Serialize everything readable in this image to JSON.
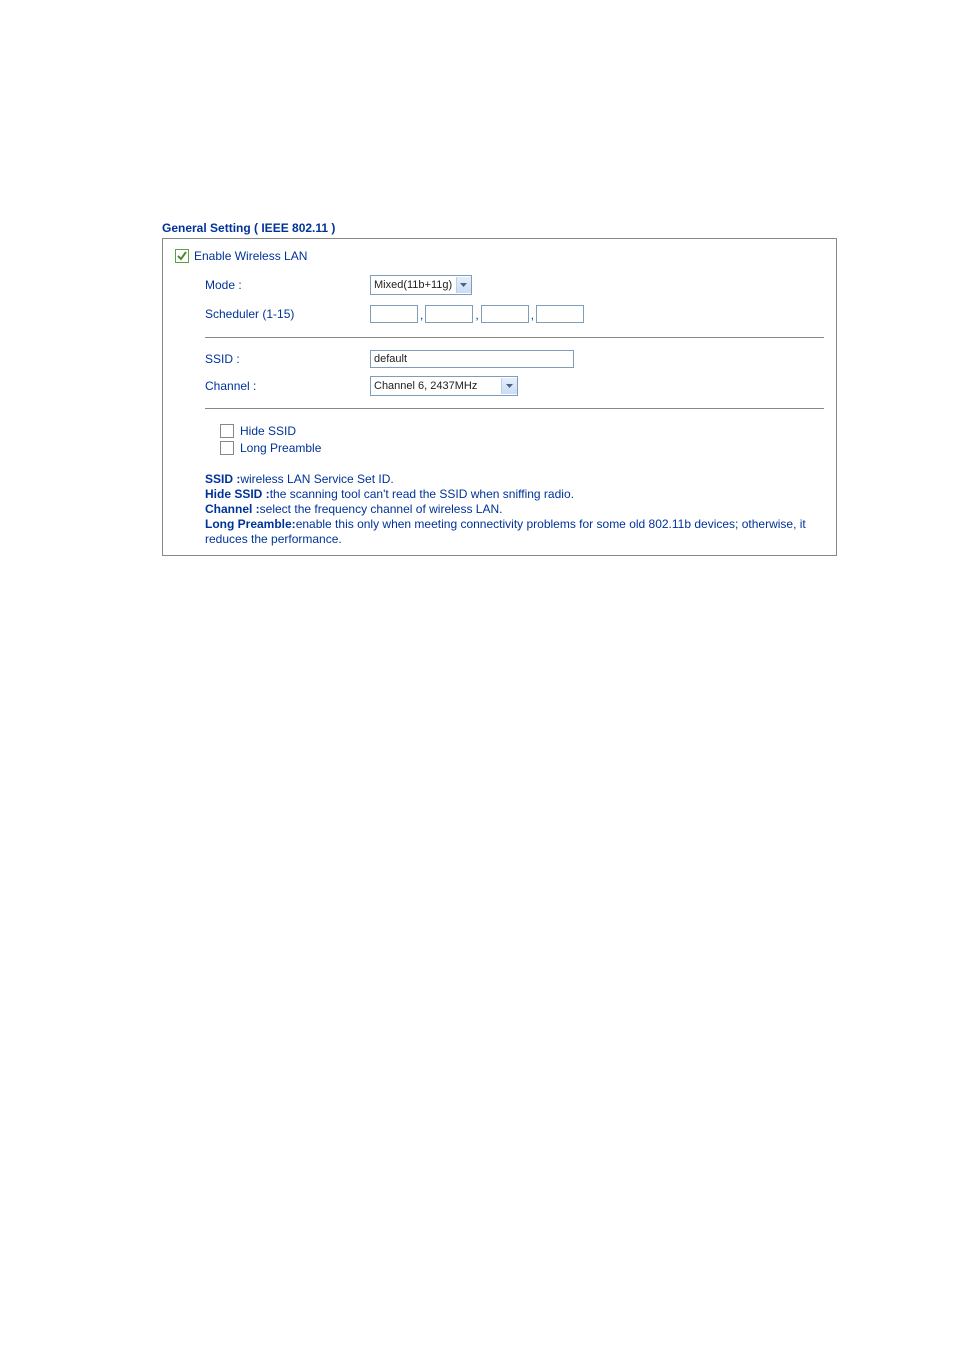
{
  "title": "General Setting ( IEEE 802.11 )",
  "enable": {
    "label": "Enable Wireless LAN",
    "checked": true
  },
  "fields": {
    "mode": {
      "label": "Mode :",
      "value": "Mixed(11b+11g)"
    },
    "scheduler": {
      "label": "Scheduler (1-15)",
      "separator": ",",
      "values": [
        "",
        "",
        "",
        ""
      ]
    },
    "ssid": {
      "label": "SSID :",
      "value": "default"
    },
    "channel": {
      "label": "Channel :",
      "value": "Channel 6, 2437MHz"
    }
  },
  "options": {
    "hide_ssid": {
      "label": "Hide SSID",
      "checked": false
    },
    "long_preamble": {
      "label": "Long Preamble",
      "checked": false
    }
  },
  "descriptions": {
    "ssid": {
      "term": "SSID :",
      "text": "wireless LAN Service Set ID."
    },
    "hide_ssid": {
      "term": "Hide SSID :",
      "text": "the scanning tool can't read the SSID when sniffing radio."
    },
    "channel": {
      "term": "Channel :",
      "text": "select the frequency channel of wireless LAN."
    },
    "long_preamble": {
      "term": "Long Preamble:",
      "text": "enable this only when meeting connectivity problems for some old 802.11b devices; otherwise, it reduces the performance."
    }
  }
}
